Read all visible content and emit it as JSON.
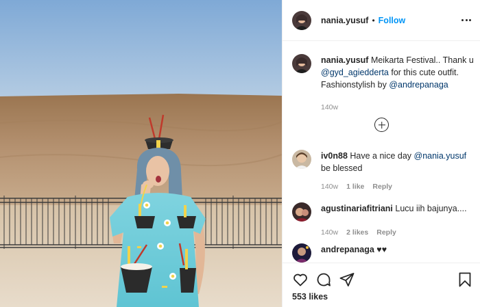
{
  "post": {
    "author": "nania.yusuf",
    "separator": "•",
    "follow_label": "Follow"
  },
  "caption": {
    "user": "nania.yusuf",
    "text_1": " Meikarta Festival.. Thank u ",
    "mention_1": "@gyd_agiedderta",
    "text_2": " for this cute outfit. Fashionstylish by ",
    "mention_2": "@andrepanaga",
    "time": "140w"
  },
  "comments": [
    {
      "user": "iv0n88",
      "text_1": " Have a nice day ",
      "mention": "@nania.yusuf",
      "text_2": " be blessed",
      "time": "140w",
      "likes": "1 like",
      "reply": "Reply"
    },
    {
      "user": "agustinariafitriani",
      "text_1": " Lucu iih bajunya....",
      "time": "140w",
      "likes": "2 likes",
      "reply": "Reply"
    },
    {
      "user": "andrepanaga",
      "text_1": " ♥♥"
    }
  ],
  "icons": {
    "more": "more-options-icon",
    "load_more": "plus-circle-icon",
    "like": "heart-icon",
    "comment": "comment-icon",
    "share": "share-icon",
    "save": "bookmark-icon"
  },
  "likes_count": "553 likes",
  "colors": {
    "link": "#0095f6",
    "mention": "#00376b",
    "muted": "#8e8e8e",
    "text": "#262626"
  }
}
